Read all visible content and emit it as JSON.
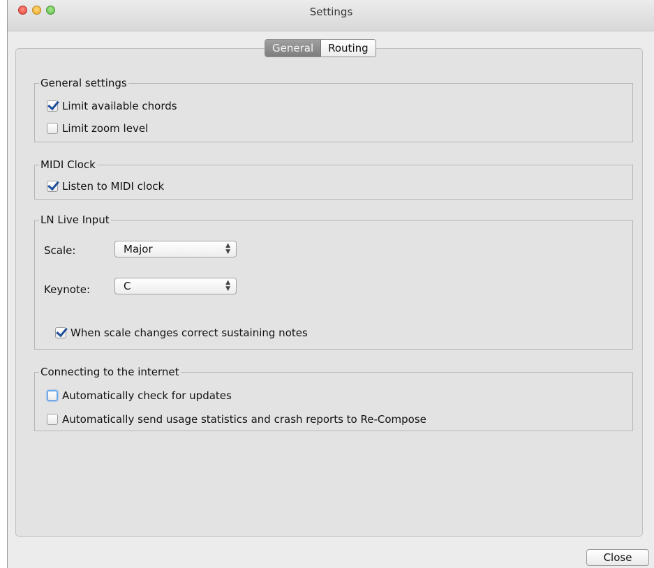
{
  "window": {
    "title": "Settings"
  },
  "tabs": [
    {
      "label": "General",
      "active": true
    },
    {
      "label": "Routing",
      "active": false
    }
  ],
  "general_settings": {
    "legend": "General settings",
    "limit_chords": {
      "label": "Limit available chords",
      "checked": true
    },
    "limit_zoom": {
      "label": "Limit zoom level",
      "checked": false
    }
  },
  "midi_clock": {
    "legend": "MIDI Clock",
    "listen": {
      "label": "Listen to MIDI clock",
      "checked": true
    }
  },
  "live_input": {
    "legend": "LN Live Input",
    "scale": {
      "label": "Scale:",
      "value": "Major"
    },
    "keynote": {
      "label": "Keynote:",
      "value": "C"
    },
    "correct_sustain": {
      "label": "When scale changes correct sustaining notes",
      "checked": true
    }
  },
  "internet": {
    "legend": "Connecting to the internet",
    "check_updates": {
      "label": "Automatically check for updates",
      "checked": false,
      "focused": true
    },
    "send_stats": {
      "label": "Automatically send usage statistics and crash reports to Re-Compose",
      "checked": false
    }
  },
  "footer": {
    "close_label": "Close"
  },
  "colors": {
    "check_accent": "#1d4f9c",
    "focus_ring": "#6fa8e8",
    "active_tab": "#8a8a8a"
  }
}
